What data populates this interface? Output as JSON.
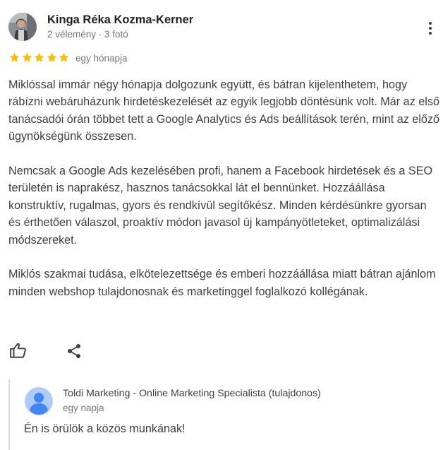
{
  "review": {
    "reviewer": {
      "name": "Kinga Réka Kozma-Kerner",
      "meta": "2 vélemény · 3 fotó",
      "avatar_icon": "user-photo"
    },
    "rating": {
      "stars": 5,
      "max_stars": 5,
      "star_color": "#fbbc04",
      "time": "egy hónapja"
    },
    "paragraphs": [
      "Miklóssal immár négy hónapja dolgozunk együtt, és bátran kijelenthetem, hogy rábízni webáruházunk hirdetéskezelését az egyik legjobb döntésünk volt. Már az első tanácsadói órán többet tett a Google Analytics és Ads beállítások terén, mint az előző ügynökségünk összesen.",
      "Nemcsak a Google Ads kezelésében profi, hanem a Facebook hirdetések és a SEO területén is naprakész, hasznos tanácsokkal lát el bennünket. Hozzáállása konstruktív, rugalmas, gyors és rendkívül segítőkész. Minden kérdésünkre gyorsan és érthetően válaszol, proaktív módon javasol új kampányötleteket, optimalizálási módszereket.",
      "Miklós szakmai tudása, elkötelezettsége és emberi hozzáállása miatt bátran ajánlom minden webshop tulajdonosnak és marketinggel foglalkozó kollégának."
    ],
    "actions": {
      "like_icon": "thumbs-up-icon",
      "share_icon": "share-icon",
      "more_icon": "more-vert-icon"
    }
  },
  "owner_response": {
    "name": "Toldi Marketing - Online Marketing Specialista (tulajdonos)",
    "time": "egy napja",
    "text": "Én is örülök a közös munkának!",
    "avatar_icon": "default-profile-icon",
    "avatar_color": "#aecbfa"
  }
}
